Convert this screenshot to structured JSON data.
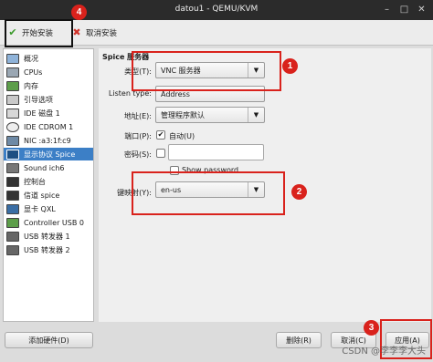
{
  "window": {
    "title": "datou1 - QEMU/KVM",
    "controls": [
      "minimize-icon",
      "maximize-icon",
      "close-icon"
    ]
  },
  "toolbar": {
    "begin_install": "开始安装",
    "cancel_install": "取消安装"
  },
  "sidebar": {
    "items": [
      {
        "label": "概况",
        "icon": "overview-icon"
      },
      {
        "label": "CPUs",
        "icon": "cpu-icon"
      },
      {
        "label": "内存",
        "icon": "memory-icon"
      },
      {
        "label": "引导选项",
        "icon": "boot-icon"
      },
      {
        "label": "IDE 磁盘 1",
        "icon": "disk-icon"
      },
      {
        "label": "IDE CDROM 1",
        "icon": "cdrom-icon"
      },
      {
        "label": "NIC :a3:1f:c9",
        "icon": "nic-icon"
      },
      {
        "label": "显示协议 Spice",
        "icon": "display-icon",
        "selected": true
      },
      {
        "label": "Sound ich6",
        "icon": "sound-icon"
      },
      {
        "label": "控制台",
        "icon": "console-icon"
      },
      {
        "label": "信道 spice",
        "icon": "channel-icon"
      },
      {
        "label": "显卡 QXL",
        "icon": "video-icon"
      },
      {
        "label": "Controller USB 0",
        "icon": "usb-controller-icon"
      },
      {
        "label": "USB 转发器 1",
        "icon": "usb-redir-icon"
      },
      {
        "label": "USB 转发器 2",
        "icon": "usb-redir-icon"
      }
    ],
    "add_hardware": "添加硬件(D)"
  },
  "spice": {
    "section_title": "Spice 服务器",
    "type_label": "类型(T):",
    "type_value": "VNC 服务器",
    "listen_label": "Listen type:",
    "listen_value": "Address",
    "address_label": "地址(E):",
    "address_value": "管理程序默认",
    "port_label": "端口(P):",
    "port_auto_label": "自动(U)",
    "password_label": "密码(S):",
    "show_password": "Show password",
    "keymap_label": "键映射(Y):",
    "keymap_value": "en-us"
  },
  "footer": {
    "remove": "删除(R)",
    "cancel": "取消(C)",
    "apply": "应用(A)"
  },
  "annotations": {
    "marker_1": "1",
    "marker_2": "2",
    "marker_3": "3",
    "marker_4": "4",
    "color": "#d9221c"
  },
  "watermark": "CSDN @李李李大头"
}
